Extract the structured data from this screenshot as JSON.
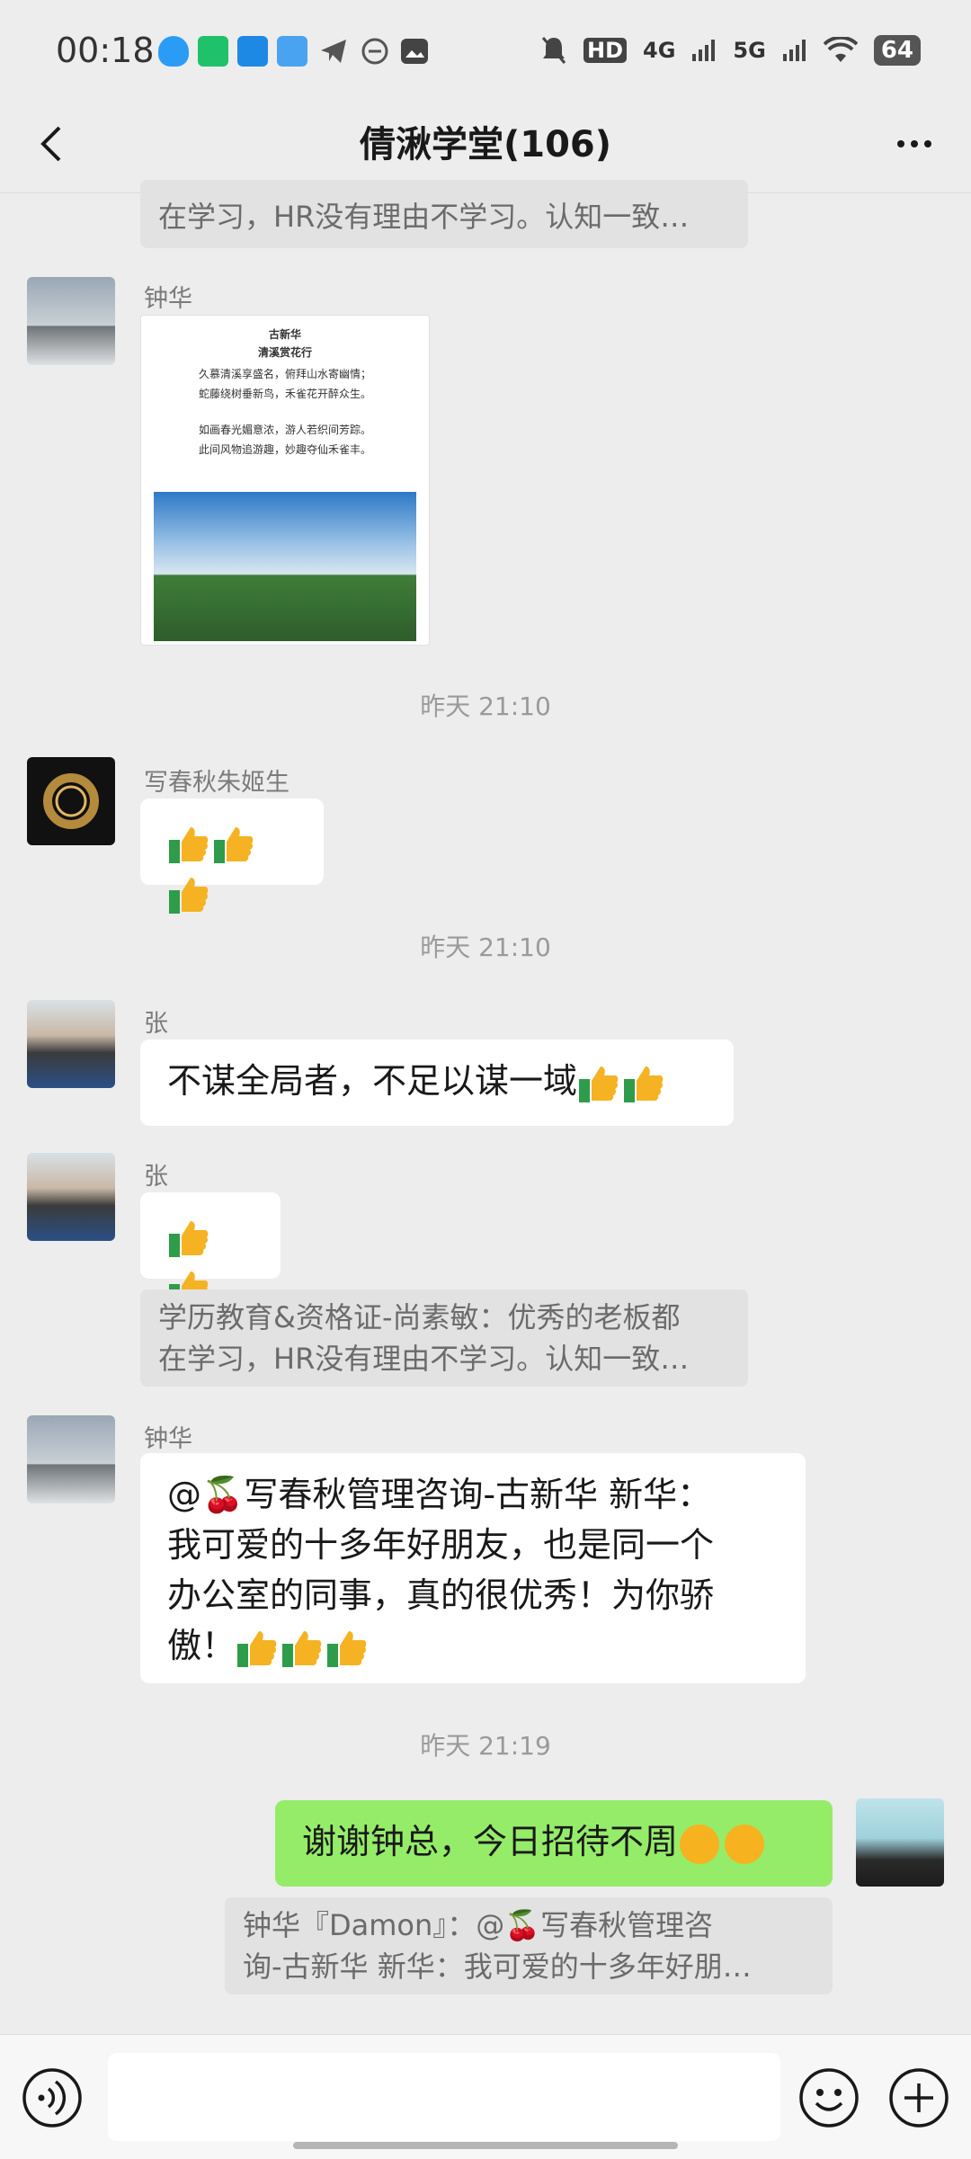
{
  "status": {
    "time": "00:18",
    "battery": "64",
    "net1": "HD",
    "net2": "4G",
    "net3": "5G"
  },
  "header": {
    "title": "倩湫学堂(106)"
  },
  "messages": {
    "top_quote_line": "在学习，HR没有理由不学习。认知一致…",
    "m1_sender": "钟华",
    "poem": {
      "author": "古新华",
      "title": "清溪赏花行",
      "l1": "久慕清溪享盛名，俯拜山水寄幽情；",
      "l2": "蛇藤绕树垂新鸟，禾雀花开醉众生。",
      "l3": "如画春光媚意浓，游人若织间芳踪。",
      "l4": "此间风物追游趣，妙趣夺仙禾雀丰。"
    },
    "ts1": "昨天 21:10",
    "m2_sender": "写春秋朱姬生",
    "ts2": "昨天 21:10",
    "m3_sender": "张",
    "m3_text": "不谋全局者，不足以谋一域",
    "m4_sender": "张",
    "m4_quote_l1": "学历教育&资格证-尚素敏：优秀的老板都",
    "m4_quote_l2": "在学习，HR没有理由不学习。认知一致…",
    "m5_sender": "钟华",
    "m5_l1": "@🍒写春秋管理咨询-古新华  新华：",
    "m5_l2": "我可爱的十多年好朋友，也是同一个",
    "m5_l3": "办公室的同事，真的很优秀！为你骄",
    "m5_l4": "傲！",
    "ts3": "昨天 21:19",
    "m6_text": "谢谢钟总，今日招待不周",
    "m6_quote_l1": "钟华『Damon』：@🍒写春秋管理咨",
    "m6_quote_l2": "询-古新华 新华：我可爱的十多年好朋…"
  },
  "colors": {
    "background": "#ededed",
    "self_bubble": "#95ec69",
    "other_bubble": "#ffffff"
  }
}
